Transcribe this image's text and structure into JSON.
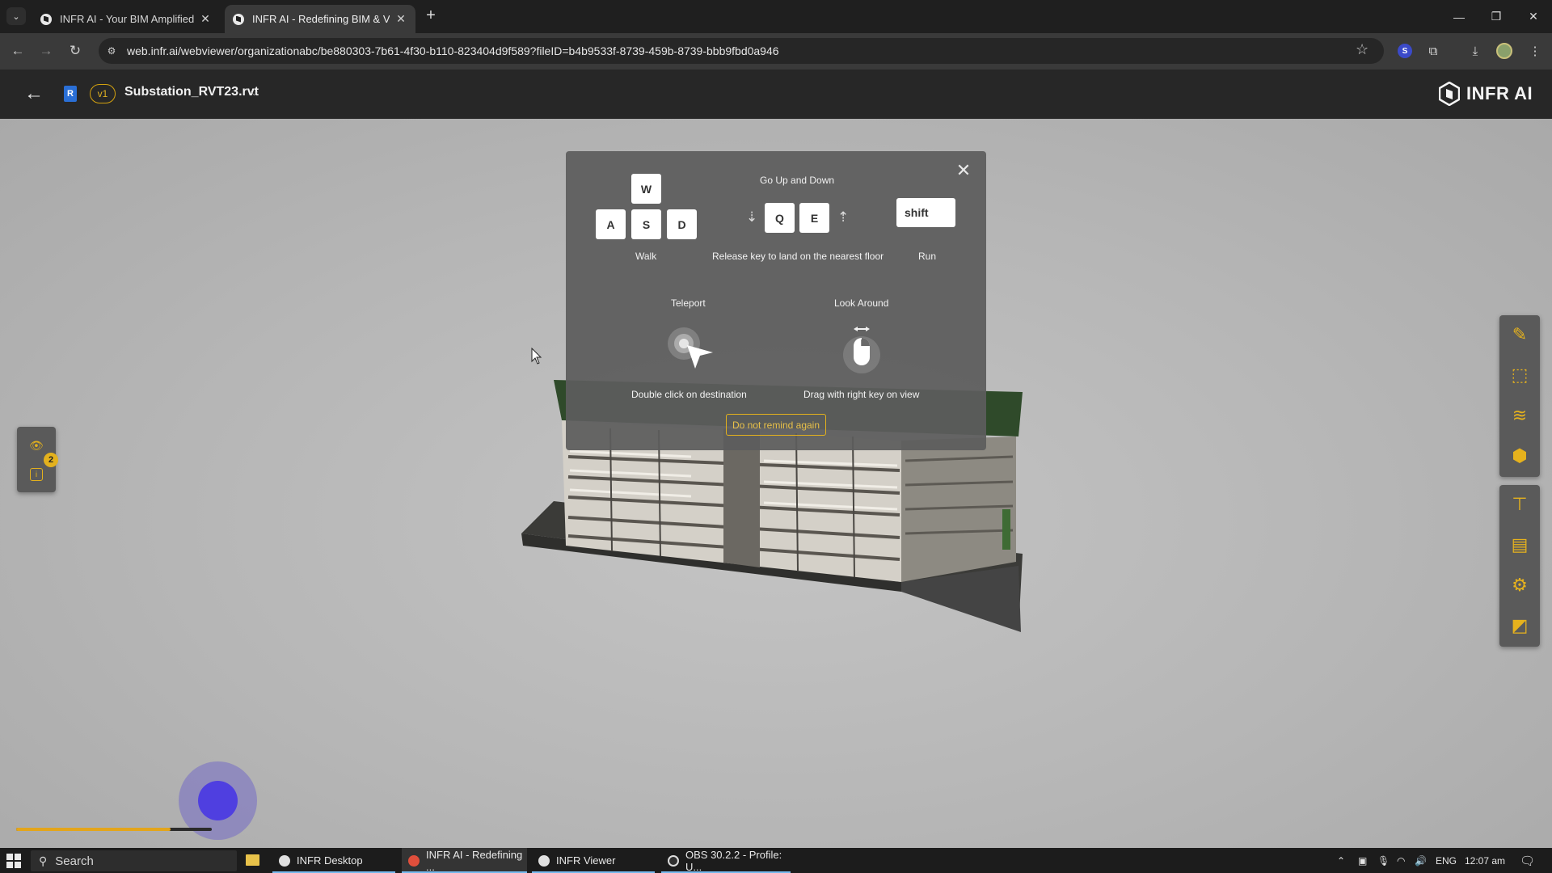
{
  "browser": {
    "tabs": [
      {
        "title": "INFR AI - Your BIM Amplified, R",
        "active": false
      },
      {
        "title": "INFR AI - Redefining BIM & VD",
        "active": true
      }
    ],
    "new_tab": "+",
    "url": "web.infr.ai/webviewer/organizationabc/be880303-7b61-4f30-b110-823404d9f589?fileID=b4b9533f-8739-459b-8739-bbb9fbd0a946",
    "extension_s": "S"
  },
  "app_header": {
    "r_badge": "R",
    "version": "v1",
    "file_name": "Substation_RVT23.rvt",
    "brand": "INFR AI"
  },
  "left_panel": {
    "visible_count": "2",
    "info_icon": "i"
  },
  "dialog": {
    "keys_walk": [
      "W",
      "A",
      "S",
      "D"
    ],
    "walk_label": "Walk",
    "updown_title": "Go Up and Down",
    "keys_updown": [
      "Q",
      "E"
    ],
    "updown_desc": "Release key to land on the nearest floor",
    "run_key": "shift",
    "run_label": "Run",
    "teleport_title": "Teleport",
    "teleport_desc": "Double click on destination",
    "look_title": "Look Around",
    "look_desc": "Drag with right key on view",
    "do_not_remind": "Do not remind again"
  },
  "progress": {
    "fraction": 0.79
  },
  "taskbar": {
    "search": "Search",
    "items": [
      {
        "label": "INFR Desktop"
      },
      {
        "label": "INFR AI - Redefining ..."
      },
      {
        "label": "INFR Viewer"
      },
      {
        "label": "OBS 30.2.2 - Profile: U..."
      }
    ],
    "language": "ENG",
    "time": "12:07 am"
  },
  "colors": {
    "accent": "#e3b11d",
    "joystick": "#4f3fe0",
    "viewport_bg": "#b6b6b6"
  }
}
